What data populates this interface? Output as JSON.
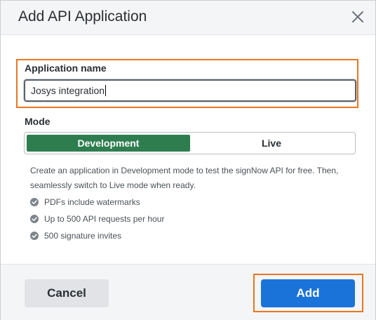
{
  "dialog": {
    "title": "Add API Application",
    "close_icon": "close-icon"
  },
  "form": {
    "name_label": "Application name",
    "name_value": "Josys integration",
    "mode_label": "Mode",
    "mode_options": [
      {
        "label": "Development",
        "selected": true
      },
      {
        "label": "Live",
        "selected": false
      }
    ],
    "description": "Create an application in Development mode to test the signNow API for free. Then, seamlessly switch to Live mode when ready.",
    "features": [
      {
        "icon": "check-circle-icon",
        "text": "PDFs include watermarks"
      },
      {
        "icon": "check-circle-icon",
        "text": "Up to 500 API requests per hour"
      },
      {
        "icon": "check-circle-icon",
        "text": "500 signature invites"
      }
    ]
  },
  "footer": {
    "cancel_label": "Cancel",
    "add_label": "Add"
  },
  "colors": {
    "highlight": "#e87722",
    "selected_mode": "#2e7d4f",
    "primary_button": "#1a73d9"
  }
}
